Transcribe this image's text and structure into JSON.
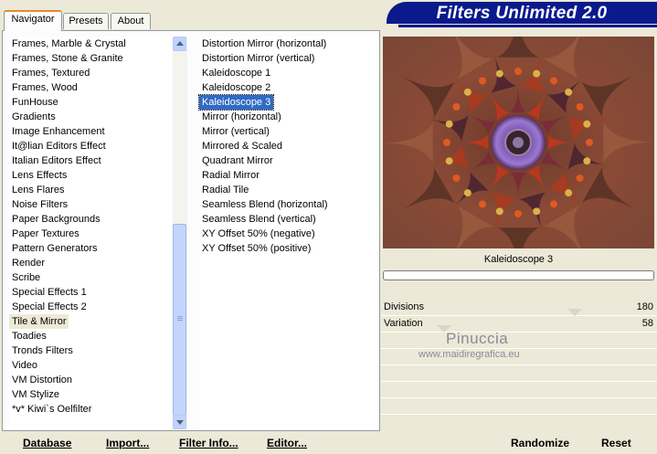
{
  "tabs": [
    {
      "label": "Navigator",
      "active": true
    },
    {
      "label": "Presets",
      "active": false
    },
    {
      "label": "About",
      "active": false
    }
  ],
  "banner": {
    "title": "Filters Unlimited 2.0",
    "color": "#0a1a8c"
  },
  "categories": [
    "Frames, Marble & Crystal",
    "Frames, Stone & Granite",
    "Frames, Textured",
    "Frames, Wood",
    "FunHouse",
    "Gradients",
    "Image Enhancement",
    "It@lian Editors Effect",
    "Italian Editors Effect",
    "Lens Effects",
    "Lens Flares",
    "Noise Filters",
    "Paper Backgrounds",
    "Paper Textures",
    "Pattern Generators",
    "Render",
    "Scribe",
    "Special Effects 1",
    "Special Effects 2",
    "Tile & Mirror",
    "Toadies",
    "Tronds Filters",
    "Video",
    "VM Distortion",
    "VM Stylize",
    "*v* Kiwi`s Oelfilter"
  ],
  "selected_category": "Tile & Mirror",
  "filters": [
    "Distortion Mirror (horizontal)",
    "Distortion Mirror (vertical)",
    "Kaleidoscope 1",
    "Kaleidoscope 2",
    "Kaleidoscope 3",
    "Mirror (horizontal)",
    "Mirror (vertical)",
    "Mirrored & Scaled",
    "Quadrant Mirror",
    "Radial Mirror",
    "Radial Tile",
    "Seamless Blend (horizontal)",
    "Seamless Blend (vertical)",
    "XY Offset 50% (negative)",
    "XY Offset 50% (positive)"
  ],
  "selected_filter": "Kaleidoscope 3",
  "preview": {
    "caption": "Kaleidoscope 3"
  },
  "params": [
    {
      "label": "Divisions",
      "value": "180"
    },
    {
      "label": "Variation",
      "value": "58"
    }
  ],
  "watermark": {
    "name": "Pinuccia",
    "url": "www.maidiregrafica.eu"
  },
  "buttons": {
    "database": "Database",
    "import": "Import...",
    "filter_info": "Filter Info...",
    "editor": "Editor...",
    "randomize": "Randomize",
    "reset": "Reset"
  },
  "colors": {
    "selection": "#316ac5",
    "face": "#ece9d8"
  }
}
